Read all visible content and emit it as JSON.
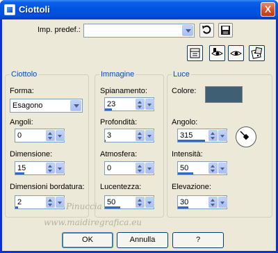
{
  "window": {
    "title": "Ciottoli",
    "close_label": "X"
  },
  "preset": {
    "label": "Imp. predef.:",
    "value": ""
  },
  "icons": {
    "reset": "reset-icon",
    "save": "save-preset-icon",
    "toggle_preview": "preview-toggle-icon",
    "proof_eye": "proof-icon",
    "auto_proof": "auto-proof-icon",
    "randomize": "randomize-dice-icon"
  },
  "ciottolo": {
    "title": "Ciottolo",
    "forma_label": "Forma:",
    "forma_value": "Esagono",
    "angoli_label": "Angoli:",
    "angoli_value": "0",
    "angoli_fill": 0,
    "dimensione_label": "Dimensione:",
    "dimensione_value": "15",
    "dimensione_fill": 0.3,
    "bordatura_label": "Dimensioni bordatura:",
    "bordatura_value": "2",
    "bordatura_fill": 0.1
  },
  "immagine": {
    "title": "Immagine",
    "spianamento_label": "Spianamento:",
    "spianamento_value": "23",
    "spianamento_fill": 0.23,
    "profondita_label": "Profondità:",
    "profondita_value": "3",
    "profondita_fill": 0.03,
    "atmosfera_label": "Atmosfera:",
    "atmosfera_value": "0",
    "atmosfera_fill": 0,
    "lucentezza_label": "Lucentezza:",
    "lucentezza_value": "50",
    "lucentezza_fill": 0.5
  },
  "luce": {
    "title": "Luce",
    "colore_label": "Colore:",
    "colore_value": "#3f5f74",
    "angolo_label": "Angolo:",
    "angolo_value": "315",
    "angolo_fill": 0.875,
    "intensita_label": "Intensità:",
    "intensita_value": "50",
    "intensita_fill": 0.5,
    "elevazione_label": "Elevazione:",
    "elevazione_value": "30",
    "elevazione_fill": 0.33
  },
  "watermark": {
    "line1": "Pinuccia",
    "line2": "www.maidiregrafica.eu"
  },
  "buttons": {
    "ok": "OK",
    "cancel": "Annulla",
    "help": "?"
  },
  "colors": {
    "titlebar": "#0054e3",
    "dialog_bg": "#ece9d8",
    "group_title": "#0046d5",
    "slider_fill": "#316ac5"
  }
}
